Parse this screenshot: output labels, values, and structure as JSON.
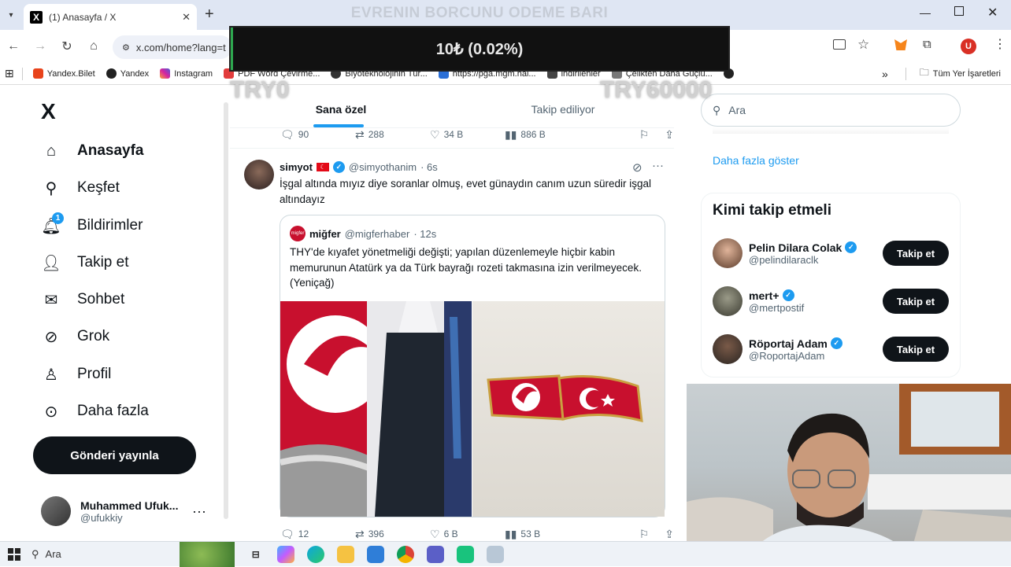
{
  "browser": {
    "tab_title": "(1) Anasayfa / X",
    "tab_favicon": "X",
    "new_tab": "+",
    "url": "x.com/home?lang=t",
    "bookmarks": [
      "Yandex.Bilet",
      "Yandex",
      "Instagram",
      "PDF Word Çevirme...",
      "Biyoteknolojinin Tür...",
      "https://pga.mgm.hal...",
      "indirilenler",
      "Çelikten Daha Güçlü..."
    ],
    "bookmarks_more": "»",
    "all_bookmarks": "Tüm Yer İşaretleri",
    "profile_initial": "U"
  },
  "overlay": {
    "title": "EVRENIN BORCUNU ODEME BARI",
    "amount": "10₺ (0.02%)",
    "min_label": "TRY0",
    "max_label": "TRY60000",
    "progress_percent": 0.02
  },
  "nav": {
    "logo": "X",
    "items": [
      "Anasayfa",
      "Keşfet",
      "Bildirimler",
      "Takip et",
      "Sohbet",
      "Grok",
      "Profil",
      "Daha fazla"
    ],
    "notification_count": "1",
    "post_button": "Gönderi yayınla",
    "account_name": "Muhammed Ufuk...",
    "account_handle": "@ufukkiy",
    "account_more": "···"
  },
  "feed": {
    "tabs": [
      "Sana özel",
      "Takip ediliyor"
    ],
    "prev_actions": {
      "replies": "90",
      "reposts": "288",
      "likes": "34 B",
      "views": "886 B"
    },
    "tweet": {
      "name": "simyot",
      "handle": "@simyothanim",
      "time": "· 6s",
      "text": "İşgal altında mıyız diye soranlar olmuş, evet günaydın canım uzun süredir işgal altındayız",
      "actions": {
        "replies": "12",
        "reposts": "396",
        "likes": "6 B",
        "views": "53 B"
      }
    },
    "quote": {
      "avatar_text": "migfer",
      "name": "miğfer",
      "handle": "@migferhaber",
      "time": "· 12s",
      "text": "THY'de kıyafet yönetmeliği değişti; yapılan düzenlemeyle hiçbir kabin memurunun Atatürk ya da Türk bayrağı rozeti takmasına izin verilmeyecek. (Yeniçağ)"
    }
  },
  "right": {
    "search_placeholder": "Ara",
    "show_more": "Daha fazla göster",
    "wtf_title": "Kimi takip etmeli",
    "suggestions": [
      {
        "name": "Pelin Dilara Colak",
        "handle": "@pelindilaraclk",
        "button": "Takip et"
      },
      {
        "name": "mert+",
        "handle": "@mertpostif",
        "button": "Takip et"
      },
      {
        "name": "Röportaj Adam",
        "handle": "@RoportajAdam",
        "button": "Takip et"
      }
    ]
  },
  "taskbar": {
    "search": "Ara"
  }
}
